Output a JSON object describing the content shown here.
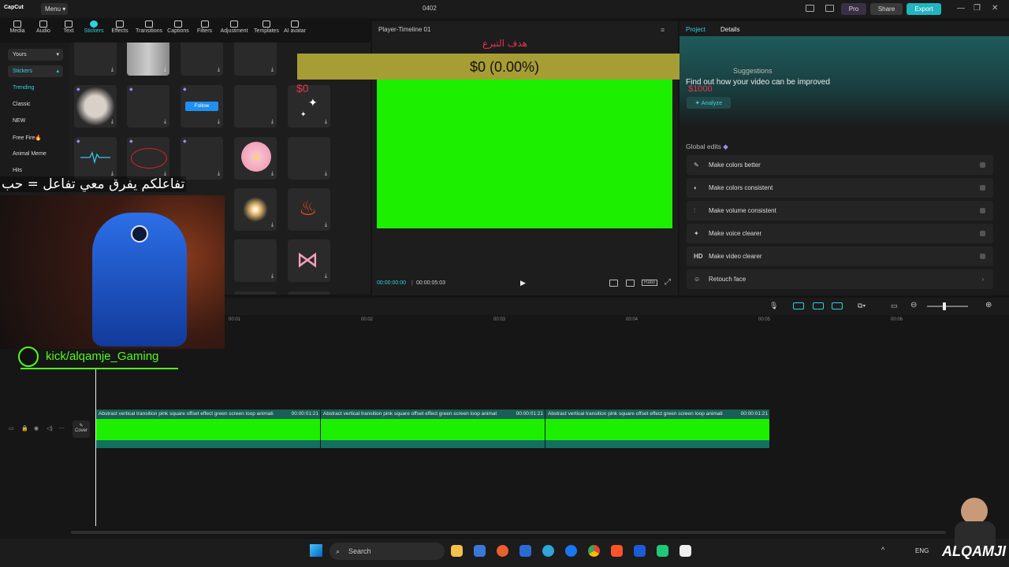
{
  "titlebar": {
    "logo": "CapCut",
    "menu": "Menu",
    "project_name": "0402",
    "pro": "Pro",
    "share": "Share",
    "export": "Export"
  },
  "tooltabs": [
    "Media",
    "Audio",
    "Text",
    "Stickers",
    "Effects",
    "Transitions",
    "Captions",
    "Filters",
    "Adjustment",
    "Templates",
    "AI avatar"
  ],
  "sidebar": {
    "yours": "Yours",
    "stickers": "Stickers",
    "items": [
      "Trending",
      "Classic",
      "NEW",
      "Free Fire🔥",
      "Animal Meme",
      "Hits"
    ]
  },
  "stickers": {
    "follow_label": "Follow",
    "dollar_label": "$0"
  },
  "player": {
    "title": "Player-Timeline 01",
    "time_current": "00:00:00:00",
    "time_total": "00:00:05:03",
    "ratio": "Ratio"
  },
  "donation": {
    "title": "هدف التبرع",
    "amount": "$0 (0.00%)",
    "mini": "$0",
    "target": "$1000"
  },
  "right_panel": {
    "tab_project": "Project",
    "tab_details": "Details",
    "suggestions_head": "Suggestions",
    "suggestions_text": "Find out how your video can be improved",
    "analyze": "Analyze",
    "global_edits": "Global edits",
    "edits": [
      {
        "icon": "✎",
        "label": "Make colors better"
      },
      {
        "icon": "◐",
        "label": "Make colors consistent"
      },
      {
        "icon": "⫶",
        "label": "Make volume consistent"
      },
      {
        "icon": "✦",
        "label": "Make voice clearer"
      },
      {
        "icon": "HD",
        "label": "Make video clearer"
      },
      {
        "icon": "☺",
        "label": "Retouch face"
      }
    ]
  },
  "timeline": {
    "ticks": [
      "00:01",
      "00:02",
      "00:03",
      "00:04",
      "00:05",
      "00:06"
    ],
    "clips": [
      {
        "label": "Abstract vertical transition pink square offset effect green screen loop animati",
        "duration": "00:00:01:21"
      },
      {
        "label": "Abstract vertical transition pink square offset effect green screen loop animat",
        "duration": "00:00:01:21"
      },
      {
        "label": "Abstract vertical transition pink square offset effect green screen loop animati",
        "duration": "00:00:01:21"
      }
    ],
    "cover": "Cover"
  },
  "overlay": {
    "caption": "تفاعلكم يفرق معي تفاعل = حب",
    "kick_handle": "kick/alqamje_Gaming",
    "brand": "ALQAMJI"
  },
  "taskbar": {
    "search": "Search",
    "lang": "ENG"
  },
  "colors": {
    "accent": "#2fd1dd",
    "green_screen": "#1cf000",
    "donation_bar": "#a79d35",
    "kick_green": "#53fc18"
  }
}
